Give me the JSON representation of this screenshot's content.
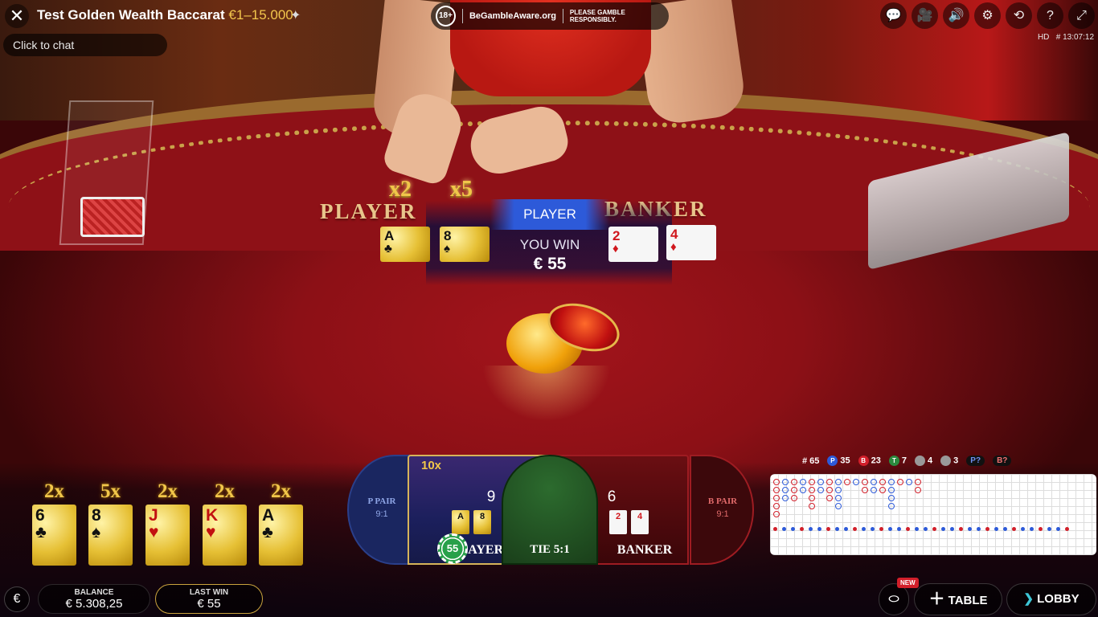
{
  "header": {
    "title": "Test Golden Wealth Baccarat",
    "limits": "€1–15.000",
    "chat_placeholder": "Click to chat",
    "rg_age": "18+",
    "rg_brand": "BeGambleAware.org",
    "rg_message": "PLEASE GAMBLE RESPONSIBLY.",
    "quality": "HD",
    "game_id": "# 13:07:12"
  },
  "table": {
    "player_label": "PLAYER",
    "banker_label": "BANKER",
    "multipliers": [
      "x2",
      "x5"
    ],
    "result_winner": "PLAYER",
    "result_text": "YOU WIN",
    "result_amount": "€ 55",
    "player_cards": [
      {
        "rank": "A",
        "suit": "♣",
        "style": "gold"
      },
      {
        "rank": "8",
        "suit": "♠",
        "style": "gold"
      }
    ],
    "banker_cards": [
      {
        "rank": "2",
        "suit": "♦",
        "style": "white"
      },
      {
        "rank": "4",
        "suit": "♦",
        "style": "white"
      }
    ]
  },
  "golden_cards": [
    {
      "mult": "2x",
      "rank": "6",
      "suit": "♣",
      "color": "black"
    },
    {
      "mult": "5x",
      "rank": "8",
      "suit": "♠",
      "color": "black"
    },
    {
      "mult": "2x",
      "rank": "J",
      "suit": "♥",
      "color": "red"
    },
    {
      "mult": "2x",
      "rank": "K",
      "suit": "♥",
      "color": "red"
    },
    {
      "mult": "2x",
      "rank": "A",
      "suit": "♣",
      "color": "black"
    }
  ],
  "bets": {
    "p_pair_label": "P PAIR",
    "p_pair_odds": "9:1",
    "player_mult": "10x",
    "player_score": "9",
    "player_label": "PLAYER",
    "player_cards": [
      "A",
      "8"
    ],
    "chip_amount": "55",
    "tie_label": "TIE 5:1",
    "banker_score": "6",
    "banker_label": "BANKER",
    "banker_cards": [
      "2",
      "4"
    ],
    "b_pair_label": "B PAIR",
    "b_pair_odds": "9:1"
  },
  "stats": {
    "rounds": "# 65",
    "player": "35",
    "banker": "23",
    "tie": "7",
    "p_pair": "4",
    "b_pair": "3",
    "p_predict": "P?",
    "b_predict": "B?"
  },
  "footer": {
    "currency_symbol": "€",
    "balance_label": "BALANCE",
    "balance_value": "€ 5.308,25",
    "lastwin_label": "LAST WIN",
    "lastwin_value": "€ 55",
    "new_badge": "NEW",
    "table_button": "TABLE",
    "lobby_button": "LOBBY"
  },
  "colors": {
    "player_blue": "#2d5ad9",
    "banker_red": "#d21f2a",
    "tie_green": "#2b8a3e",
    "gold": "#f1c64a"
  }
}
